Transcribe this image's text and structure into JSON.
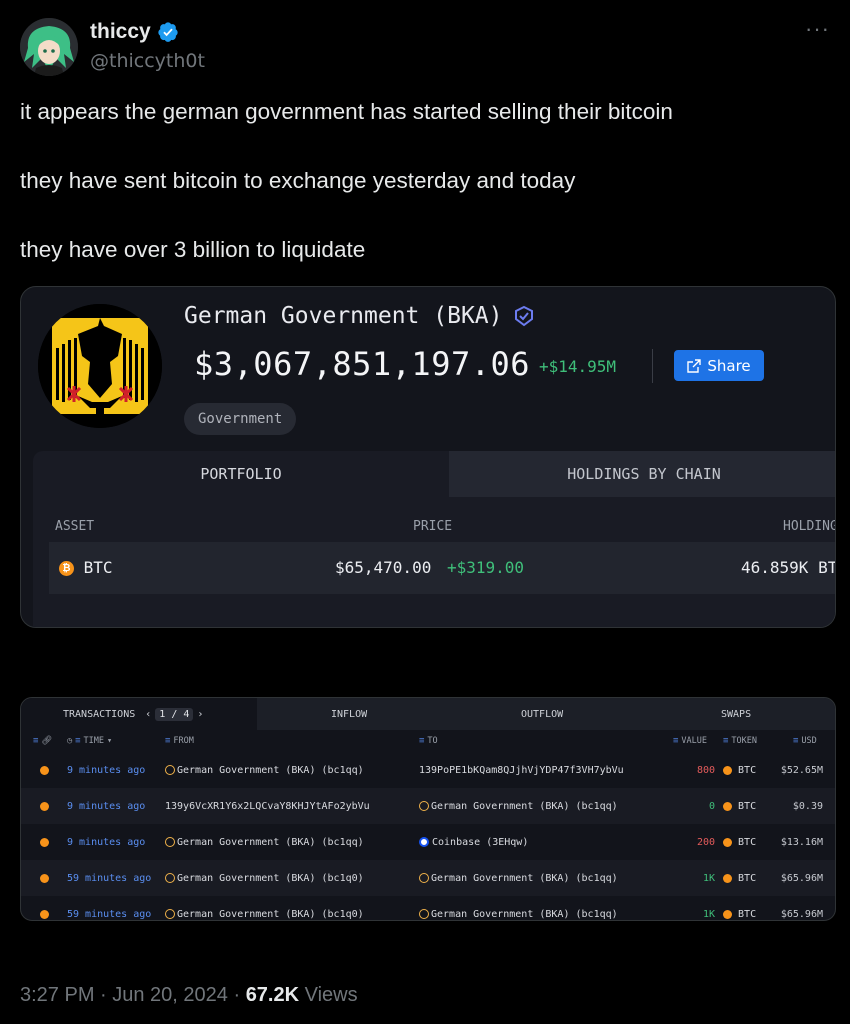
{
  "tweet": {
    "display_name": "thiccy",
    "handle": "@thiccyth0t",
    "more_label": "···",
    "lines": [
      "it appears the german government has started selling their bitcoin",
      "they have sent bitcoin to exchange yesterday and today",
      "they have over 3 billion to liquidate"
    ],
    "timestamp": "3:27 PM · Jun 20, 2024 · ",
    "views_count": "67.2K",
    "views_label": " Views"
  },
  "entity_card": {
    "name": "German Government (BKA)",
    "value": "$3,067,851,197.06",
    "change": "+$14.95M",
    "share_label": "Share",
    "tag": "Government",
    "tabs": [
      "PORTFOLIO",
      "HOLDINGS BY CHAIN"
    ],
    "columns": [
      "ASSET",
      "PRICE",
      "HOLDING"
    ],
    "rows": [
      {
        "asset": "BTC",
        "price": "$65,470.00",
        "price_change": "+$319.00",
        "holding": "46.859K BT"
      }
    ]
  },
  "tx_card": {
    "tabs": {
      "transactions": "TRANSACTIONS",
      "page": "1 / 4",
      "inflow": "INFLOW",
      "outflow": "OUTFLOW",
      "swaps": "SWAPS"
    },
    "columns": {
      "time": "TIME",
      "from": "FROM",
      "to": "TO",
      "value": "VALUE",
      "token": "TOKEN",
      "usd": "USD"
    },
    "rows": [
      {
        "time": "9 minutes ago",
        "from": "German Government (BKA)",
        "from_tag": "(bc1qq)",
        "to": "139PoPE1bKQam8QJjhVjYDP47f3VH7ybVu",
        "to_tag": "",
        "value": "800",
        "token": "BTC",
        "usd": "$52.65M"
      },
      {
        "time": "9 minutes ago",
        "from": "139y6VcXR1Y6x2LQCvaY8KHJYtAFo2ybVu",
        "from_tag": "",
        "to": "German Government (BKA)",
        "to_tag": "(bc1qq)",
        "value": "0",
        "token": "BTC",
        "usd": "$0.39"
      },
      {
        "time": "9 minutes ago",
        "from": "German Government (BKA)",
        "from_tag": "(bc1qq)",
        "to": "Coinbase",
        "to_tag": "(3EHqw)",
        "value": "200",
        "token": "BTC",
        "usd": "$13.16M"
      },
      {
        "time": "59 minutes ago",
        "from": "German Government (BKA)",
        "from_tag": "(bc1q0)",
        "to": "German Government (BKA)",
        "to_tag": "(bc1qq)",
        "value": "1K",
        "token": "BTC",
        "usd": "$65.96M"
      },
      {
        "time": "59 minutes ago",
        "from": "German Government (BKA)",
        "from_tag": "(bc1q0)",
        "to": "German Government (BKA)",
        "to_tag": "(bc1qq)",
        "value": "1K",
        "token": "BTC",
        "usd": "$65.96M"
      }
    ]
  },
  "colors": {
    "accent_blue": "#1d9bf0",
    "gain_green": "#3fbf7a",
    "loss_red": "#e45b5b",
    "btc_orange": "#f7931a"
  }
}
